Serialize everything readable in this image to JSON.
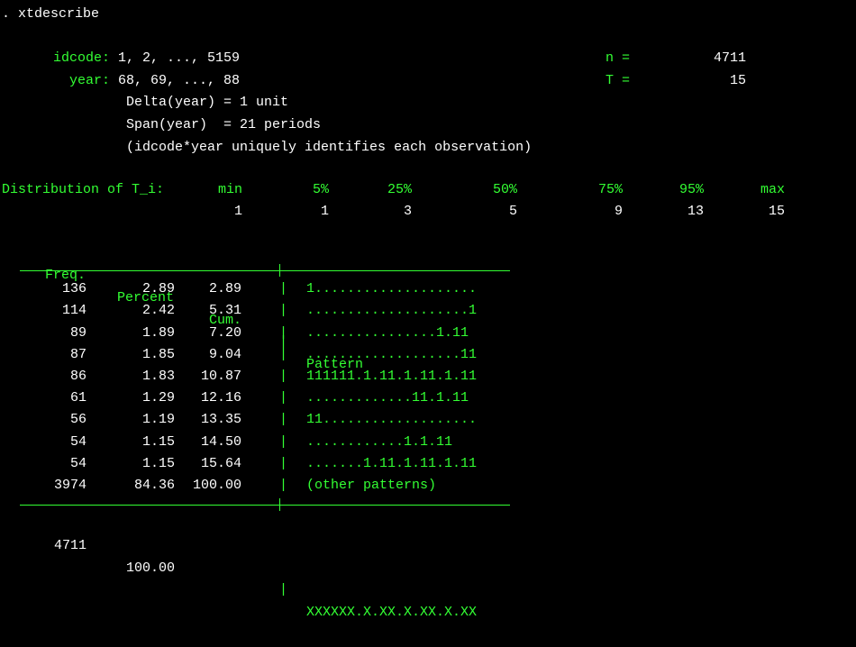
{
  "command": ". xtdescribe",
  "panelvar": {
    "label": "idcode:",
    "range": "1, 2, ..., 5159",
    "n_label": "n =",
    "n_value": "4711"
  },
  "timevar": {
    "label": "year:",
    "range": "68, 69, ..., 88",
    "T_label": "T =",
    "T_value": "15"
  },
  "delta_line": "Delta(year) = 1 unit",
  "span_line": "Span(year)  = 21 periods",
  "unique_line": "(idcode*year uniquely identifies each observation)",
  "dist": {
    "label": "Distribution of T_i:",
    "headers": {
      "min": "min",
      "p5": "5%",
      "p25": "25%",
      "p50": "50%",
      "p75": "75%",
      "p95": "95%",
      "max": "max"
    },
    "values": {
      "min": "1",
      "p5": "1",
      "p25": "3",
      "p50": "5",
      "p75": "9",
      "p95": "13",
      "max": "15"
    }
  },
  "table": {
    "hdr_freq": "Freq.",
    "hdr_percent": "Percent",
    "hdr_cum": "Cum.",
    "hdr_pattern": "Pattern",
    "rows": [
      {
        "freq": "136",
        "pct": "2.89",
        "cum": "2.89",
        "pattern": "1...................."
      },
      {
        "freq": "114",
        "pct": "2.42",
        "cum": "5.31",
        "pattern": "....................1"
      },
      {
        "freq": "89",
        "pct": "1.89",
        "cum": "7.20",
        "pattern": "................1.11"
      },
      {
        "freq": "87",
        "pct": "1.85",
        "cum": "9.04",
        "pattern": "...................11"
      },
      {
        "freq": "86",
        "pct": "1.83",
        "cum": "10.87",
        "pattern": "111111.1.11.1.11.1.11"
      },
      {
        "freq": "61",
        "pct": "1.29",
        "cum": "12.16",
        "pattern": ".............11.1.11"
      },
      {
        "freq": "56",
        "pct": "1.19",
        "cum": "13.35",
        "pattern": "11..................."
      },
      {
        "freq": "54",
        "pct": "1.15",
        "cum": "14.50",
        "pattern": "............1.1.11"
      },
      {
        "freq": "54",
        "pct": "1.15",
        "cum": "15.64",
        "pattern": ".......1.11.1.11.1.11"
      },
      {
        "freq": "3974",
        "pct": "84.36",
        "cum": "100.00",
        "pattern": "(other patterns)"
      }
    ],
    "total": {
      "freq": "4711",
      "pct": "100.00",
      "pattern": "XXXXXX.X.XX.X.XX.X.XX"
    }
  }
}
